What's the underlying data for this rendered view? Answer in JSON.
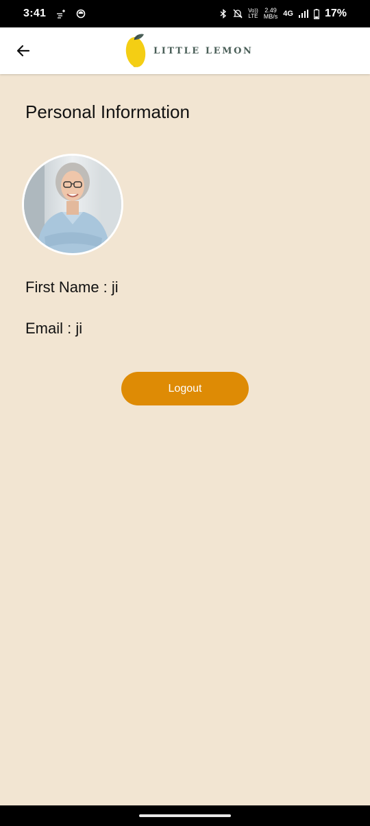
{
  "status_bar": {
    "time": "3:41",
    "net_speed_value": "2.49",
    "net_speed_unit": "MB/s",
    "volte_top": "Vo))",
    "volte_bottom": "LTE",
    "network_type": "4G",
    "battery_percent": "17%"
  },
  "app_bar": {
    "logo_text": "LITTLE LEMON",
    "brand_color": "#495e57",
    "lemon_color": "#f4ce14"
  },
  "profile": {
    "title": "Personal Information",
    "first_name_field": "First Name : ji",
    "email_field": "Email : ji"
  },
  "actions": {
    "logout_label": "Logout",
    "button_color": "#de8b05"
  },
  "theme": {
    "background": "#f2e5d2"
  }
}
